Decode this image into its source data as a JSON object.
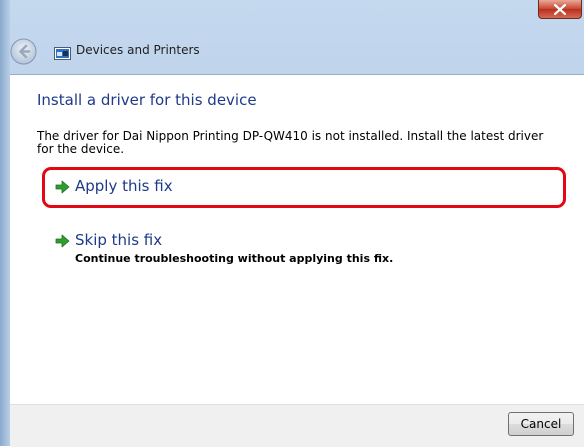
{
  "window": {
    "title": "Devices and Printers"
  },
  "content": {
    "heading": "Install a driver for this device",
    "description": "The driver for Dai Nippon Printing DP-QW410 is not installed. Install the latest driver for the device."
  },
  "options": [
    {
      "label": "Apply this fix",
      "sublabel": "",
      "highlighted": true
    },
    {
      "label": "Skip this fix",
      "sublabel": "Continue troubleshooting without applying this fix.",
      "highlighted": false
    }
  ],
  "footer": {
    "cancel_label": "Cancel"
  },
  "icons": {
    "close": "close-icon",
    "back": "back-arrow-icon",
    "app": "devices-and-printers-icon",
    "option": "green-arrow-icon"
  },
  "colors": {
    "link_text": "#1e3a8a",
    "highlight_border": "#e30613",
    "arrow_green": "#2e9e2e"
  }
}
